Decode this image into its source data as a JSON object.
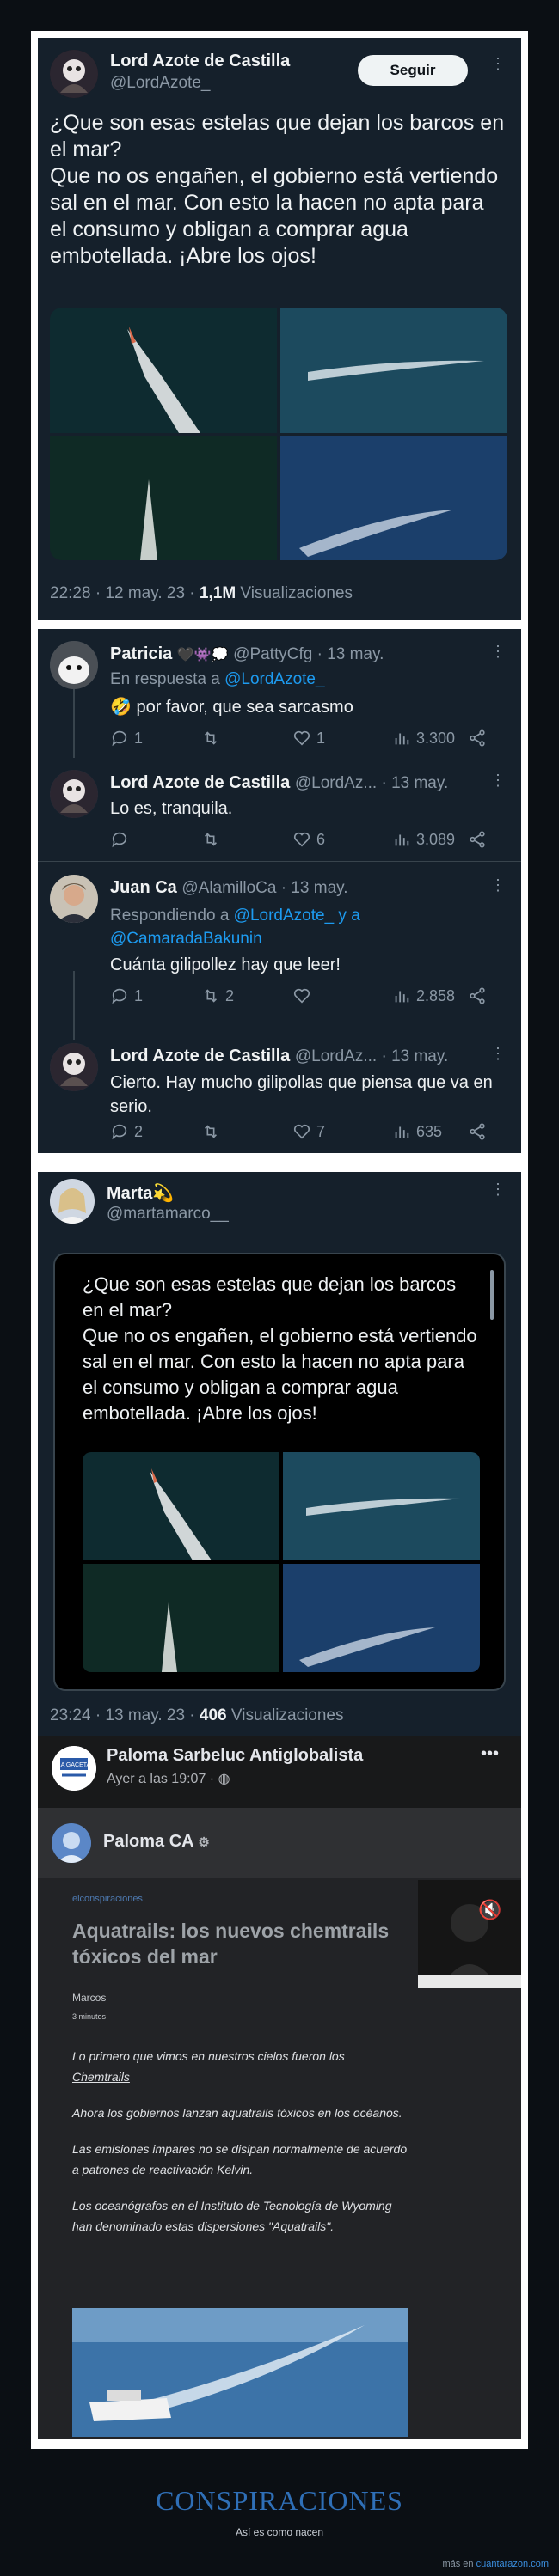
{
  "tweet1": {
    "name": "Lord Azote de Castilla",
    "handle": "@LordAzote_",
    "follow": "Seguir",
    "text": "¿Que son esas estelas que dejan los barcos en el mar?\nQue no os engañen, el gobierno está vertiendo sal en el mar. Con esto la hacen no apta para el consumo y obligan a comprar agua embotellada. ¡Abre los ojos!",
    "time": "22:28 · 12 may. 23 · ",
    "views": "1,1M",
    "views_label": " Visualizaciones"
  },
  "thread": [
    {
      "name": "Patricia",
      "emoji": "🖤👾💭",
      "meta": "@PattyCfg · 13 may.",
      "reply_prefix": "En respuesta a ",
      "reply_to": "@LordAzote_",
      "text": "🤣 por favor, que sea sarcasmo",
      "replies": "1",
      "retweets": "",
      "likes": "1",
      "views": "3.300"
    },
    {
      "name": "Lord Azote de Castilla",
      "meta": "@LordAz... · 13 may.",
      "text": "Lo es, tranquila.",
      "replies": "",
      "retweets": "",
      "likes": "6",
      "views": "3.089"
    },
    {
      "name": "Juan Ca",
      "meta": "@AlamilloCa · 13 may.",
      "reply_prefix": "Respondiendo a ",
      "reply_to": "@LordAzote_ y a @CamaradaBakunin",
      "text": "Cuánta gilipollez hay que leer!",
      "replies": "1",
      "retweets": "2",
      "likes": "",
      "views": "2.858"
    },
    {
      "name": "Lord Azote de Castilla",
      "meta": "@LordAz... · 13 may.",
      "text": "Cierto. Hay mucho gilipollas que piensa que va en serio.",
      "replies": "2",
      "retweets": "",
      "likes": "7",
      "views": "635"
    }
  ],
  "tweet3": {
    "name": "Marta💫",
    "handle": "@martamarco__",
    "quote_text": "¿Que son esas estelas que dejan los barcos en el mar?\nQue no os engañen, el gobierno está vertiendo sal en el mar. Con esto la hacen no apta para el consumo y obligan a comprar agua embotellada. ¡Abre los ojos!",
    "time": "23:24 · 13 may. 23 · ",
    "views": "406",
    "views_label": " Visualizaciones"
  },
  "facebook": {
    "name": "Paloma Sarbeluc Antiglobalista",
    "time": "Ayer a las 19:07 · ",
    "more": "•••",
    "inner_name": "Paloma CA",
    "site": "elconspiraciones",
    "article_title": "Aquatrails: los nuevos chemtrails tóxicos del mar",
    "author": "Marcos",
    "read_time": "3 minutos",
    "p1": "Lo primero que vimos en nuestros cielos fueron los",
    "p1_link": "Chemtrails",
    "p2": "Ahora los gobiernos lanzan aquatrails tóxicos en los océanos.",
    "p3": "Las emisiones impares no se disipan normalmente de acuerdo a patrones de reactivación Kelvin.",
    "p4": "Los oceanógrafos en el Instituto de Tecnología de Wyoming han denominado estas dispersiones \"Aquatrails\"."
  },
  "footer": {
    "title": "CONSPIRACIONES",
    "subtitle": "Así es como nacen",
    "credit_prefix": "más en ",
    "credit_link": "cuantarazon.com"
  }
}
